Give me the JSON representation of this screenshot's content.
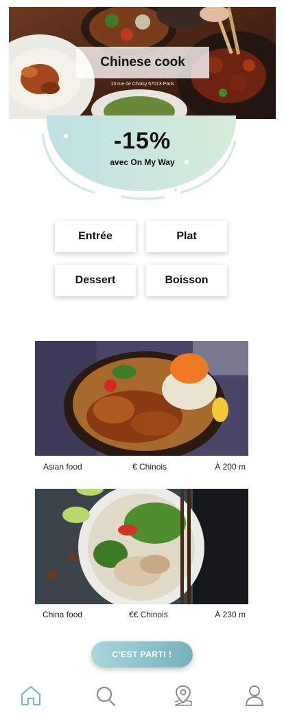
{
  "restaurant": {
    "name": "Chinese cook",
    "address": "13 rue de Choisy 57013 Paris"
  },
  "promo": {
    "discount": "-15%",
    "caption": "avec On My Way"
  },
  "categories": [
    {
      "label": "Entrée"
    },
    {
      "label": "Plat"
    },
    {
      "label": "Dessert"
    },
    {
      "label": "Boisson"
    }
  ],
  "dishes": [
    {
      "name": "Asian food",
      "price": "€ Chinois",
      "distance": "À 200 m"
    },
    {
      "name": "China food",
      "price": "€€ Chinois",
      "distance": "À 230 m"
    }
  ],
  "cta": {
    "label": "C'EST PARTI !"
  },
  "nav": {
    "items": [
      {
        "icon": "home-icon",
        "active": true
      },
      {
        "icon": "search-icon",
        "active": false
      },
      {
        "icon": "map-pin-icon",
        "active": false
      },
      {
        "icon": "user-icon",
        "active": false
      }
    ]
  },
  "colors": {
    "accent": "#7fb8c2",
    "promo_blob": "#cfe8e2",
    "nav_inactive": "#8a8a8a"
  }
}
